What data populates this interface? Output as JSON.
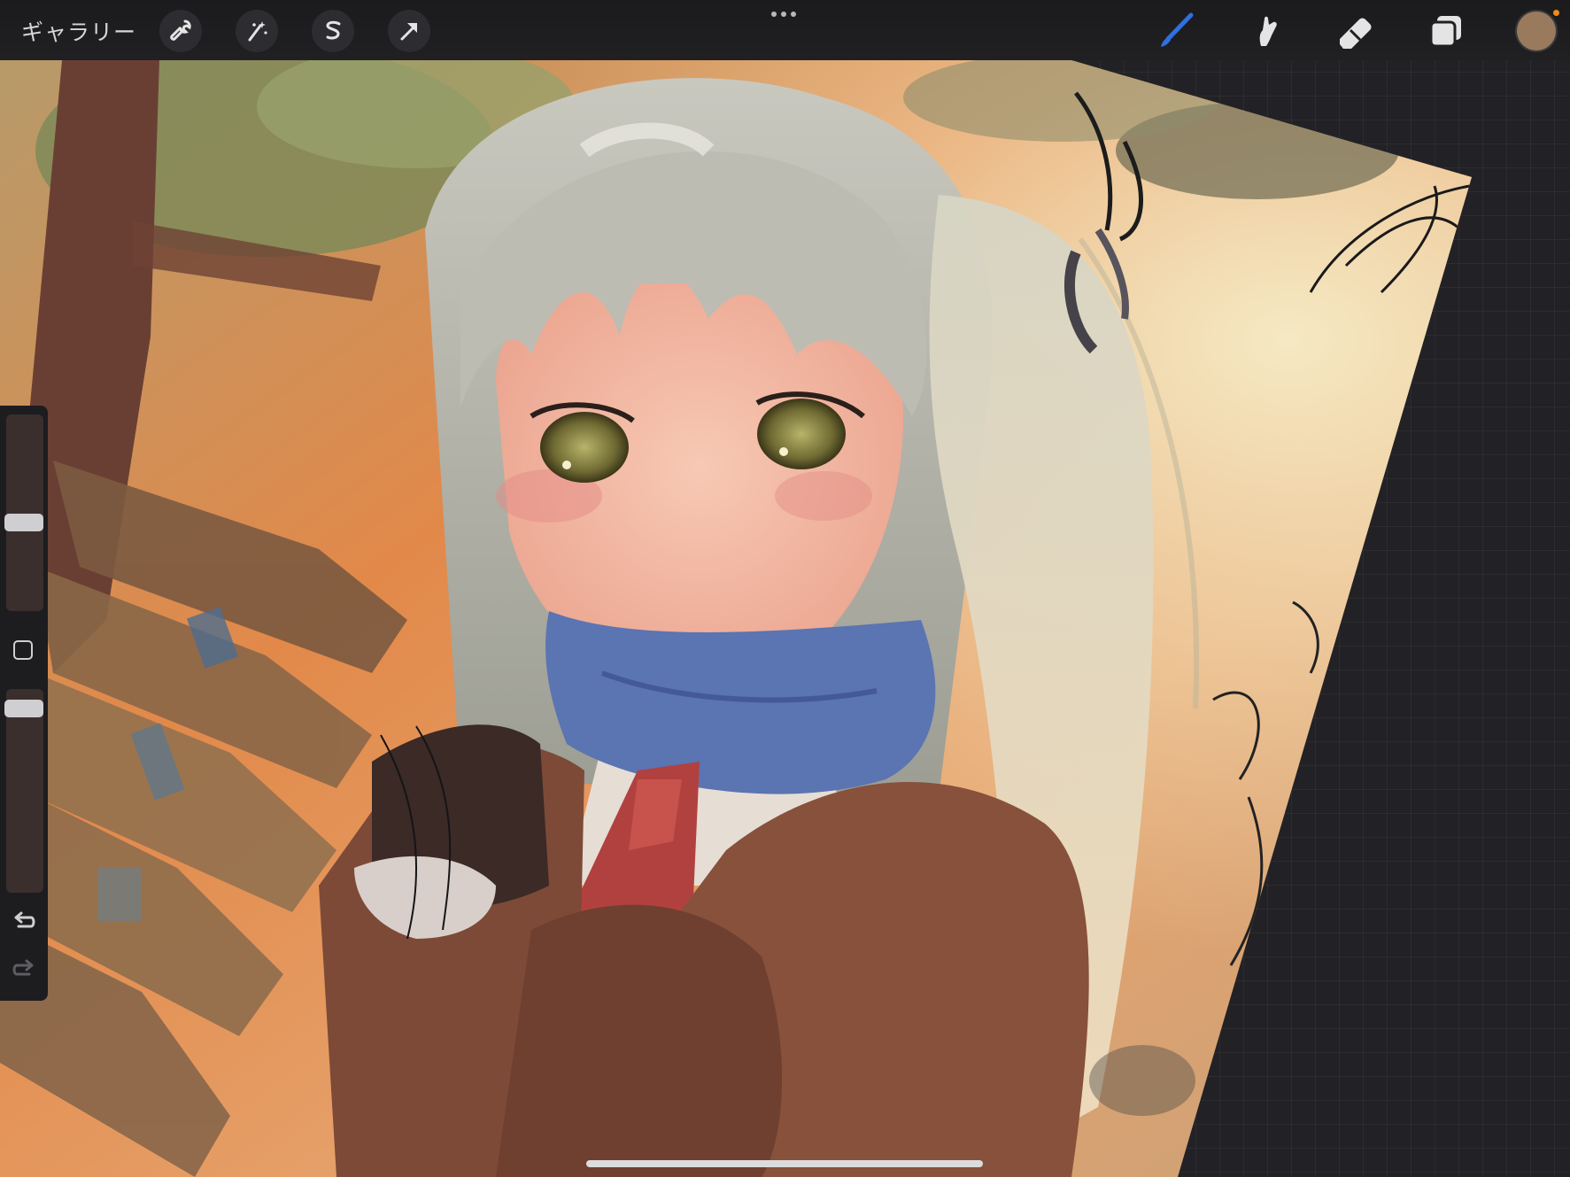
{
  "toolbar": {
    "gallery_label": "ギャラリー",
    "left_tools": [
      "wrench-icon",
      "magic-wand-icon",
      "selection-icon",
      "transform-arrow-icon"
    ],
    "right_tools": [
      "brush-icon",
      "smudge-icon",
      "eraser-icon",
      "layers-icon"
    ],
    "active_tool": "brush",
    "accent_color": "#2f6fe0",
    "current_color": "#9a7a5c"
  },
  "sidebar": {
    "brush_size_level": 0.42,
    "opacity_level": 0.95,
    "undo_icon": "undo-icon",
    "redo_icon": "redo-icon"
  }
}
